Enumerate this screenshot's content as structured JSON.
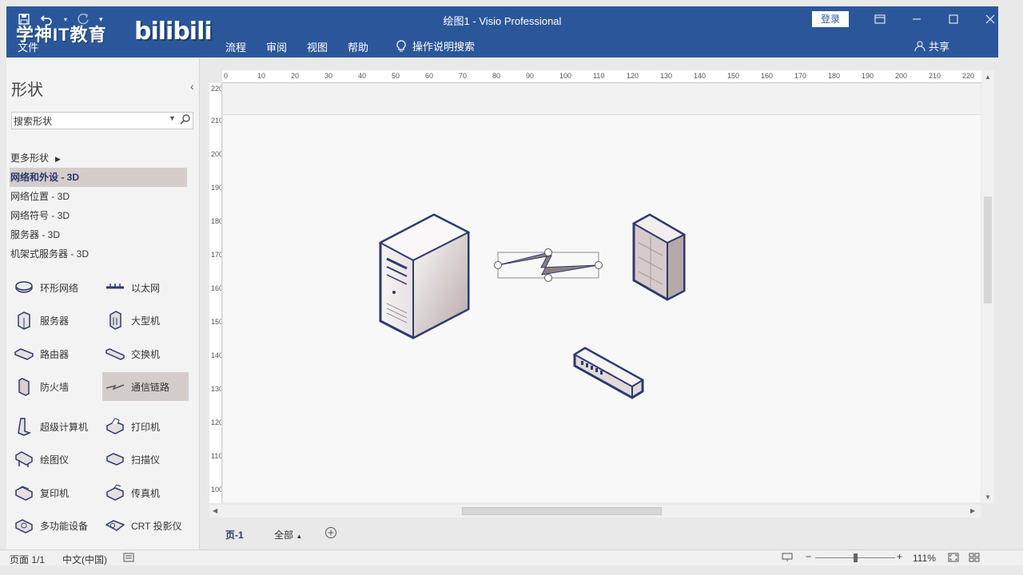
{
  "titlebar": {
    "qat": [
      "save-icon",
      "undo-icon",
      "redo-icon",
      "customize-icon"
    ],
    "title": "绘图1  -  Visio Professional",
    "login": "登录"
  },
  "watermark": {
    "text": "学神IT教育",
    "logo": "bilibili"
  },
  "ribbon": {
    "tabs": [
      "文件",
      "流程",
      "审阅",
      "视图",
      "帮助"
    ],
    "tell_me": "操作说明搜索",
    "share": "共享"
  },
  "shapes_panel": {
    "title": "形状",
    "search_value": "搜索形状",
    "more_shapes": "更多形状",
    "stencils": [
      "网络和外设 - 3D",
      "网络位置 - 3D",
      "网络符号 - 3D",
      "服务器 - 3D",
      "机架式服务器 - 3D"
    ],
    "shapes": [
      {
        "label": "环形网络",
        "icon": "ring-network-icon"
      },
      {
        "label": "以太网",
        "icon": "ethernet-icon"
      },
      {
        "label": "服务器",
        "icon": "server-icon"
      },
      {
        "label": "大型机",
        "icon": "mainframe-icon"
      },
      {
        "label": "路由器",
        "icon": "router-icon"
      },
      {
        "label": "交换机",
        "icon": "switch-icon"
      },
      {
        "label": "防火墙",
        "icon": "firewall-icon"
      },
      {
        "label": "通信链路",
        "icon": "comm-link-icon"
      },
      {
        "label": "超级计算机",
        "icon": "supercomputer-icon"
      },
      {
        "label": "打印机",
        "icon": "printer-icon"
      },
      {
        "label": "绘图仪",
        "icon": "plotter-icon"
      },
      {
        "label": "扫描仪",
        "icon": "scanner-icon"
      },
      {
        "label": "复印机",
        "icon": "copier-icon"
      },
      {
        "label": "传真机",
        "icon": "fax-icon"
      },
      {
        "label": "多功能设备",
        "icon": "mfp-icon"
      },
      {
        "label": "CRT 投影仪",
        "icon": "projector-icon"
      }
    ]
  },
  "rulers": {
    "h": [
      "0",
      "10",
      "20",
      "30",
      "40",
      "50",
      "60",
      "70",
      "80",
      "90",
      "100",
      "110",
      "120",
      "130",
      "140",
      "150",
      "160",
      "170",
      "180",
      "190",
      "200",
      "210",
      "220"
    ],
    "v": [
      "220",
      "210",
      "200",
      "190",
      "180",
      "170",
      "160",
      "150",
      "140",
      "130",
      "120",
      "110",
      "100"
    ]
  },
  "pages": {
    "current": "页-1",
    "all": "全部"
  },
  "status": {
    "page": "页面 1/1",
    "lang": "中文(中国)",
    "zoom": "111%"
  },
  "colors": {
    "ribbon": "#2b579a",
    "selected": "#d5cccc"
  }
}
